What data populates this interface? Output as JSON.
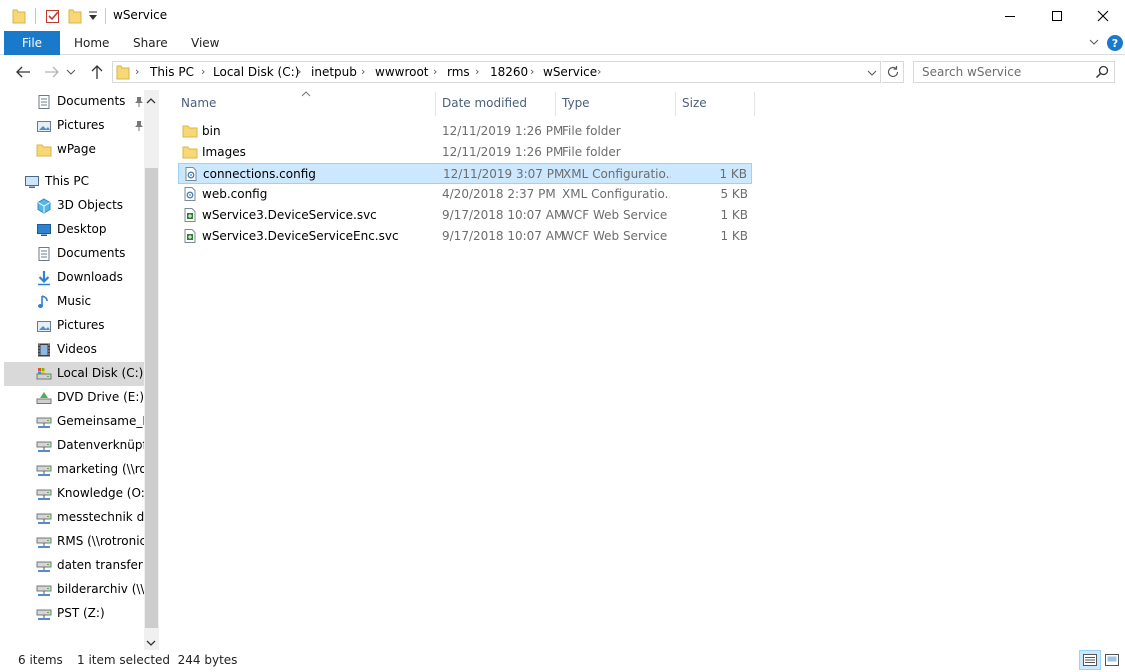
{
  "window": {
    "title": "wService",
    "minimize_icon": "minimize-icon",
    "maximize_icon": "maximize-icon",
    "close_icon": "close-icon"
  },
  "ribbon": {
    "tabs": [
      "File",
      "Home",
      "Share",
      "View"
    ],
    "accent": "#1979ca",
    "help_label": "?"
  },
  "address": {
    "crumbs": [
      "This PC",
      "Local Disk (C:)",
      "inetpub",
      "wwwroot",
      "rms",
      "18260",
      "wService"
    ]
  },
  "search": {
    "placeholder": "Search wService"
  },
  "nav": {
    "items": [
      {
        "label": "Documents",
        "icon": "documents-icon",
        "pinned": true
      },
      {
        "label": "Pictures",
        "icon": "pictures-icon",
        "pinned": true
      },
      {
        "label": "wPage",
        "icon": "folder-icon",
        "pinned": false
      },
      {
        "label": "This PC",
        "icon": "this-pc-icon",
        "pinned": false
      },
      {
        "label": "3D Objects",
        "icon": "3d-objects-icon",
        "pinned": false
      },
      {
        "label": "Desktop",
        "icon": "desktop-icon",
        "pinned": false
      },
      {
        "label": "Documents",
        "icon": "documents-icon",
        "pinned": false
      },
      {
        "label": "Downloads",
        "icon": "downloads-icon",
        "pinned": false
      },
      {
        "label": "Music",
        "icon": "music-icon",
        "pinned": false
      },
      {
        "label": "Pictures",
        "icon": "pictures-icon",
        "pinned": false
      },
      {
        "label": "Videos",
        "icon": "videos-icon",
        "pinned": false
      },
      {
        "label": "Local Disk (C:)",
        "icon": "local-disk-icon",
        "pinned": false,
        "selected": true
      },
      {
        "label": "DVD Drive (E:) SS",
        "icon": "dvd-drive-icon",
        "pinned": false
      },
      {
        "label": "Gemeinsame_Da",
        "icon": "network-drive-icon",
        "pinned": false
      },
      {
        "label": "Datenverknüpfu",
        "icon": "network-drive-icon",
        "pinned": false
      },
      {
        "label": "marketing (\\\\rot",
        "icon": "network-drive-icon",
        "pinned": false
      },
      {
        "label": "Knowledge (O:)",
        "icon": "network-drive-icon",
        "pinned": false
      },
      {
        "label": "messtechnik dat",
        "icon": "network-drive-icon",
        "pinned": false
      },
      {
        "label": "RMS (\\\\rotronic.",
        "icon": "network-drive-icon",
        "pinned": false
      },
      {
        "label": "daten transfer (\\\\",
        "icon": "network-drive-icon",
        "pinned": false
      },
      {
        "label": "bilderarchiv (\\\\ro",
        "icon": "network-drive-icon",
        "pinned": false
      },
      {
        "label": "PST (Z:)",
        "icon": "network-drive-icon",
        "pinned": false
      }
    ]
  },
  "columns": {
    "name": "Name",
    "date": "Date modified",
    "type": "Type",
    "size": "Size"
  },
  "files": [
    {
      "name": "bin",
      "date": "12/11/2019 1:26 PM",
      "type": "File folder",
      "size": "",
      "icon": "folder-icon"
    },
    {
      "name": "Images",
      "date": "12/11/2019 1:26 PM",
      "type": "File folder",
      "size": "",
      "icon": "folder-icon"
    },
    {
      "name": "connections.config",
      "date": "12/11/2019 3:07 PM",
      "type": "XML Configuratio...",
      "size": "1 KB",
      "icon": "config-file-icon",
      "selected": true
    },
    {
      "name": "web.config",
      "date": "4/20/2018 2:37 PM",
      "type": "XML Configuratio...",
      "size": "5 KB",
      "icon": "config-file-icon"
    },
    {
      "name": "wService3.DeviceService.svc",
      "date": "9/17/2018 10:07 AM",
      "type": "WCF Web Service",
      "size": "1 KB",
      "icon": "svc-file-icon"
    },
    {
      "name": "wService3.DeviceServiceEnc.svc",
      "date": "9/17/2018 10:07 AM",
      "type": "WCF Web Service",
      "size": "1 KB",
      "icon": "svc-file-icon"
    }
  ],
  "status": {
    "item_count": "6 items",
    "selection": "1 item selected  244 bytes"
  }
}
